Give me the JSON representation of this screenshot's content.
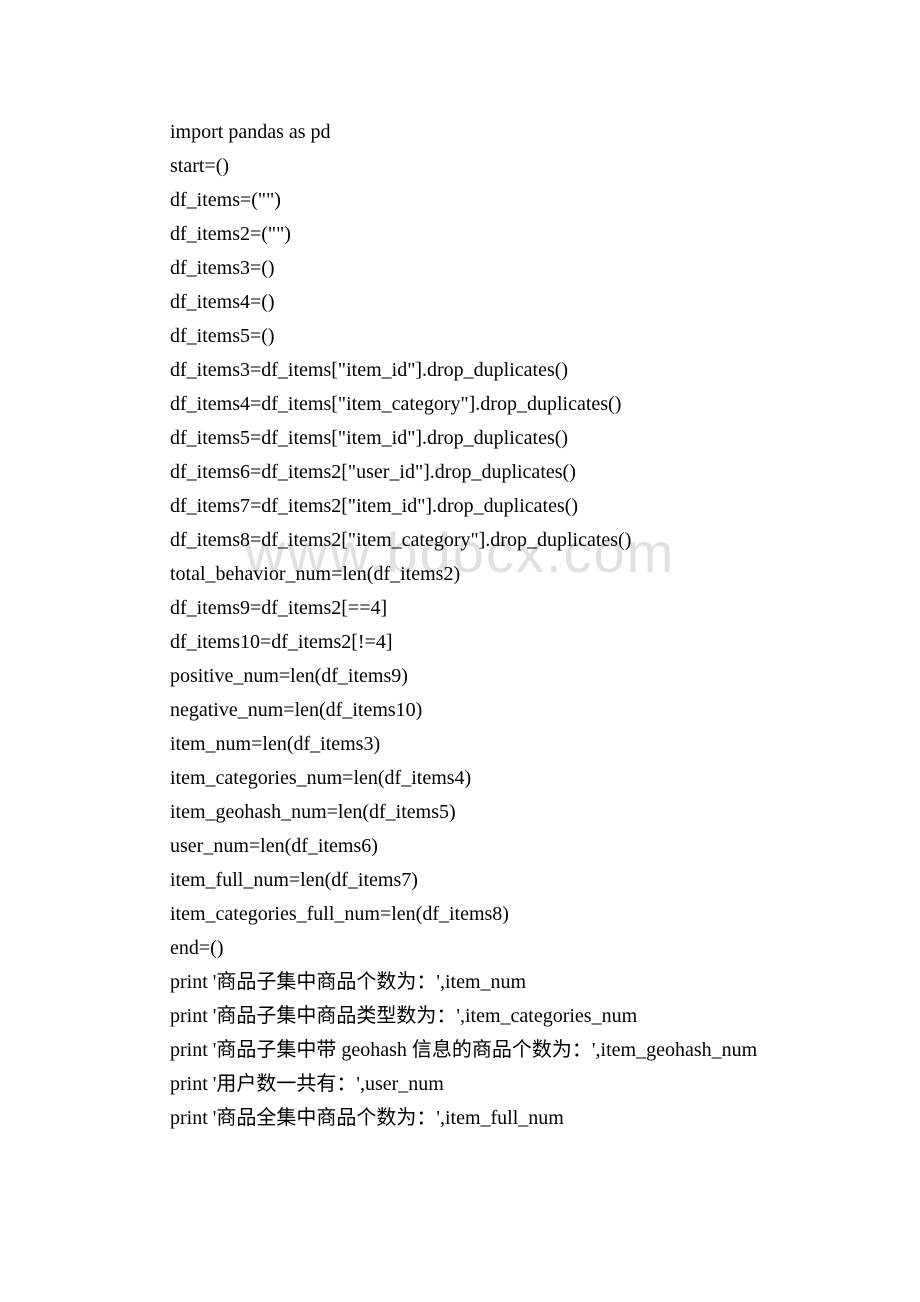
{
  "watermark": "www.bdocx.com",
  "lines": [
    "import pandas as pd",
    "start=()",
    "df_items=(\"\")",
    "df_items2=(\"\")",
    "df_items3=()",
    "df_items4=()",
    "df_items5=()",
    "df_items3=df_items[\"item_id\"].drop_duplicates()",
    "df_items4=df_items[\"item_category\"].drop_duplicates()",
    "df_items5=df_items[\"item_id\"].drop_duplicates()",
    "df_items6=df_items2[\"user_id\"].drop_duplicates()",
    "df_items7=df_items2[\"item_id\"].drop_duplicates()",
    "df_items8=df_items2[\"item_category\"].drop_duplicates()",
    "total_behavior_num=len(df_items2)",
    "df_items9=df_items2[==4]",
    "df_items10=df_items2[!=4]",
    "positive_num=len(df_items9)",
    "negative_num=len(df_items10)",
    "item_num=len(df_items3)",
    "item_categories_num=len(df_items4)",
    "item_geohash_num=len(df_items5)",
    "user_num=len(df_items6)",
    "item_full_num=len(df_items7)",
    "item_categories_full_num=len(df_items8)",
    "end=()",
    "print '商品子集中商品个数为：',item_num",
    "print '商品子集中商品类型数为：',item_categories_num",
    "print '商品子集中带 geohash 信息的商品个数为：',item_geohash_num",
    "print '用户数一共有：',user_num",
    "print '商品全集中商品个数为：',item_full_num"
  ]
}
